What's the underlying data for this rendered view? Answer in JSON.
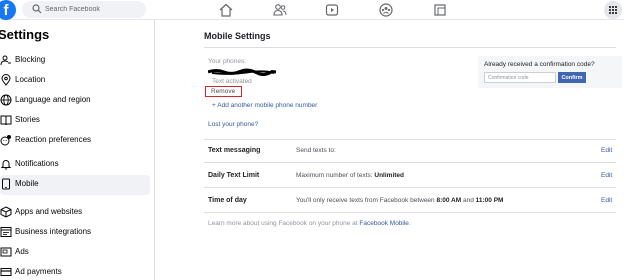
{
  "topbar": {
    "logo": "f",
    "search_placeholder": "Search Facebook",
    "icons": [
      "search-icon",
      "home-icon",
      "friends-icon",
      "watch-icon",
      "groups-icon",
      "gaming-icon",
      "menu-grid-icon"
    ]
  },
  "sidebar": {
    "title": "Settings",
    "items": [
      {
        "label": "Blocking",
        "icon": "blocking-icon"
      },
      {
        "label": "Location",
        "icon": "location-pin-icon"
      },
      {
        "label": "Language and region",
        "icon": "globe-icon"
      },
      {
        "label": "Stories",
        "icon": "book-icon"
      },
      {
        "label": "Reaction preferences",
        "icon": "reaction-icon"
      },
      {
        "label": "Notifications",
        "icon": "bell-icon"
      },
      {
        "label": "Mobile",
        "icon": "phone-icon",
        "active": true
      },
      {
        "label": "Apps and websites",
        "icon": "cube-icon"
      },
      {
        "label": "Business integrations",
        "icon": "business-icon"
      },
      {
        "label": "Ads",
        "icon": "ads-icon"
      },
      {
        "label": "Ad payments",
        "icon": "card-icon"
      }
    ]
  },
  "main": {
    "title": "Mobile Settings",
    "phones_label": "Your phones:",
    "text_activated": "Text activated",
    "remove_label": "Remove",
    "add_phone_label": "+ Add another mobile phone number",
    "lost_phone_label": "Lost your phone?",
    "confirm": {
      "question": "Already received a confirmation code?",
      "input_placeholder": "Confirmation code",
      "button_label": "Confirm"
    },
    "rows": [
      {
        "label": "Text messaging",
        "desc": "Send texts to:",
        "edit": "Edit"
      },
      {
        "label": "Daily Text Limit",
        "desc_prefix": "Maximum number of texts: ",
        "desc_bold": "Unlimited",
        "edit": "Edit"
      },
      {
        "label": "Time of day",
        "desc_prefix": "You'll only receive texts from Facebook between ",
        "desc_bold1": "8:00 AM",
        "desc_mid": " and ",
        "desc_bold2": "11:00 PM",
        "edit": "Edit"
      }
    ],
    "footer_prefix": "Learn more about using Facebook on your phone at ",
    "footer_link": "Facebook Mobile",
    "footer_suffix": "."
  },
  "colors": {
    "brand": "#1877f2",
    "link": "#385898",
    "button": "#4267b2",
    "highlight_border": "#d9252a"
  }
}
